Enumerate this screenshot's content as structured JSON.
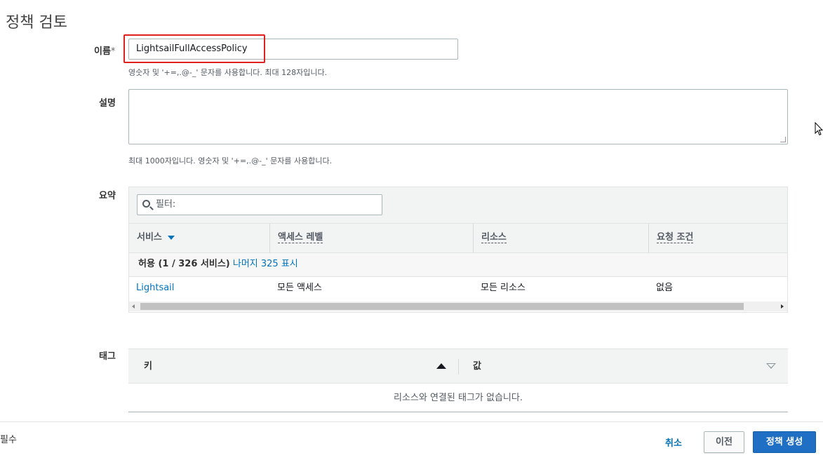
{
  "page_title": "정책 검토",
  "form": {
    "name_label": "이름",
    "name_required_mark": "*",
    "name_value": "LightsailFullAccessPolicy",
    "name_hint": "영숫자 및 '+=,.@-_' 문자를 사용합니다. 최대 128자입니다.",
    "description_label": "설명",
    "description_value": "",
    "description_hint": "최대 1000자입니다. 영숫자 및 '+=,.@-_' 문자를 사용합니다."
  },
  "summary": {
    "label": "요약",
    "filter_placeholder": "필터:",
    "columns": [
      "서비스",
      "액세스 레벨",
      "리소스",
      "요청 조건"
    ],
    "group_label": "허용 (1 / 326 서비스)",
    "group_link": "나머지 325 표시",
    "rows": [
      {
        "service": "Lightsail",
        "access_level": "모든 액세스",
        "resource": "모든 리소스",
        "condition": "없음"
      }
    ]
  },
  "tags": {
    "label": "태그",
    "columns": [
      "키",
      "값"
    ],
    "empty_message": "리소스와 연결된 태그가 없습니다."
  },
  "footer": {
    "required_note": "필수",
    "cancel_label": "취소",
    "previous_label": "이전",
    "create_label": "정책 생성"
  },
  "colors": {
    "link": "#0073bb",
    "primary_button": "#1f6fc5",
    "highlight_border": "#e0201e"
  }
}
